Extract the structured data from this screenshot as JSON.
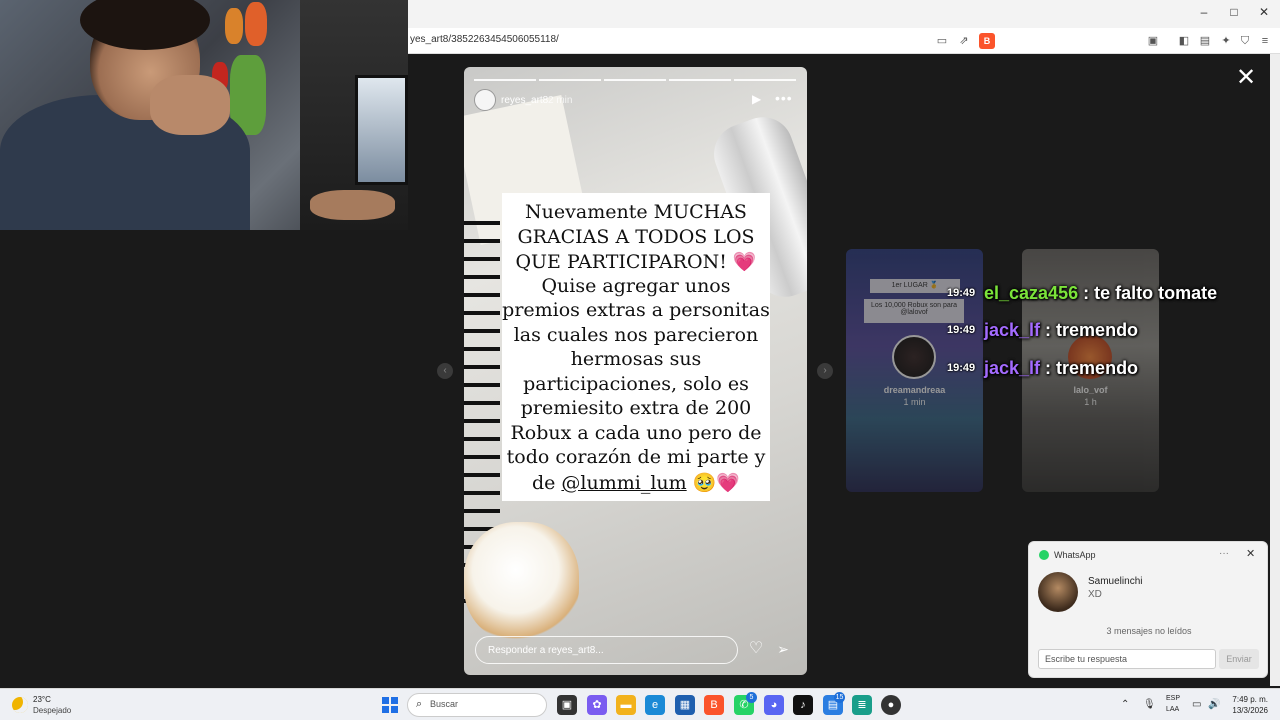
{
  "browser": {
    "url": "yes_art8/3852263454506055118/",
    "window_controls": [
      "–",
      "□",
      "✕"
    ]
  },
  "story": {
    "username": "reyes_art8",
    "time": "2 min",
    "text_lines": [
      "Nuevamente MUCHAS",
      "GRACIAS A TODOS LOS",
      "QUE PARTICIPARON! 💗",
      "Quise agregar unos",
      "premios extras a personitas",
      "las cuales nos parecieron",
      "hermosas sus",
      "participaciones, solo es",
      "premiesito extra de 200",
      "Robux a cada uno pero de",
      "todo corazón de mi parte y"
    ],
    "last_line_prefix": "de ",
    "mention": "@lummi_lum",
    "last_line_suffix": " 🥹💗",
    "reply_placeholder": "Responder a reyes_art8..."
  },
  "previews": [
    {
      "name": "dreamandreaa",
      "time": "1 min",
      "card_lines": [
        "1er LUGAR 🥇",
        "Los 10,000 Robux son para",
        "@lalovof"
      ]
    },
    {
      "name": "lalo_vof",
      "time": "1 h"
    }
  ],
  "chat": [
    {
      "time": "19:49",
      "user": "el_caza456",
      "message": " : te falto tomate",
      "color": "#7be33a"
    },
    {
      "time": "19:49",
      "user": "jack_lf",
      "message": " : tremendo",
      "color": "#a46bff"
    },
    {
      "time": "19:49",
      "user": "jack_lf",
      "message": " : tremendo",
      "color": "#a46bff"
    }
  ],
  "notification": {
    "app": "WhatsApp",
    "dots": "···",
    "close": "✕",
    "contact": "Samuelinchi",
    "message": "XD",
    "unread": "3 mensajes no leídos",
    "reply_placeholder": "Escribe tu respuesta",
    "send": "Enviar"
  },
  "taskbar": {
    "temperature": "23°C",
    "condition": "Despejado",
    "search": "Buscar",
    "whatsapp_badge": "5",
    "store_badge": "15",
    "lang1": "ESP",
    "lang2": "LAA",
    "time": "7:49 p. m.",
    "date": "13/3/2026"
  }
}
